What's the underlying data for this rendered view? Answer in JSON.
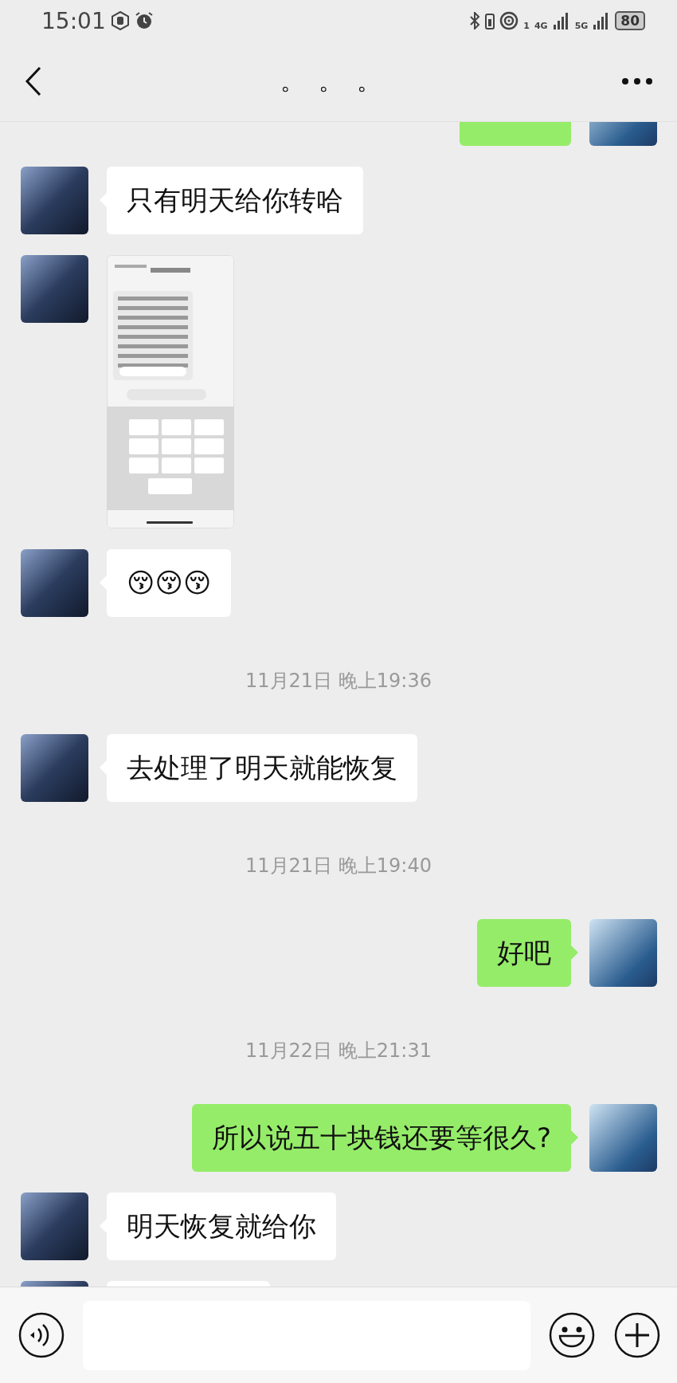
{
  "status_bar": {
    "time": "15:01",
    "wifi_sup": "1",
    "net_a": "4G",
    "net_b": "5G",
    "battery": "80"
  },
  "header": {
    "title": "。 。 。"
  },
  "messages": [
    {
      "kind": "partial",
      "outgoing": true
    },
    {
      "kind": "text",
      "outgoing": false,
      "text": "只有明天给你转哈"
    },
    {
      "kind": "image",
      "outgoing": false
    },
    {
      "kind": "text",
      "outgoing": false,
      "text": "😚😚😚"
    },
    {
      "kind": "time",
      "text": "11月21日 晚上19:36"
    },
    {
      "kind": "text",
      "outgoing": false,
      "text": "去处理了明天就能恢复"
    },
    {
      "kind": "time",
      "text": "11月21日 晚上19:40"
    },
    {
      "kind": "text",
      "outgoing": true,
      "text": "好吧"
    },
    {
      "kind": "time",
      "text": "11月22日 晚上21:31"
    },
    {
      "kind": "text",
      "outgoing": true,
      "text": "所以说五十块钱还要等很久?"
    },
    {
      "kind": "text",
      "outgoing": false,
      "text": "明天恢复就给你"
    },
    {
      "kind": "partial",
      "outgoing": false
    }
  ]
}
